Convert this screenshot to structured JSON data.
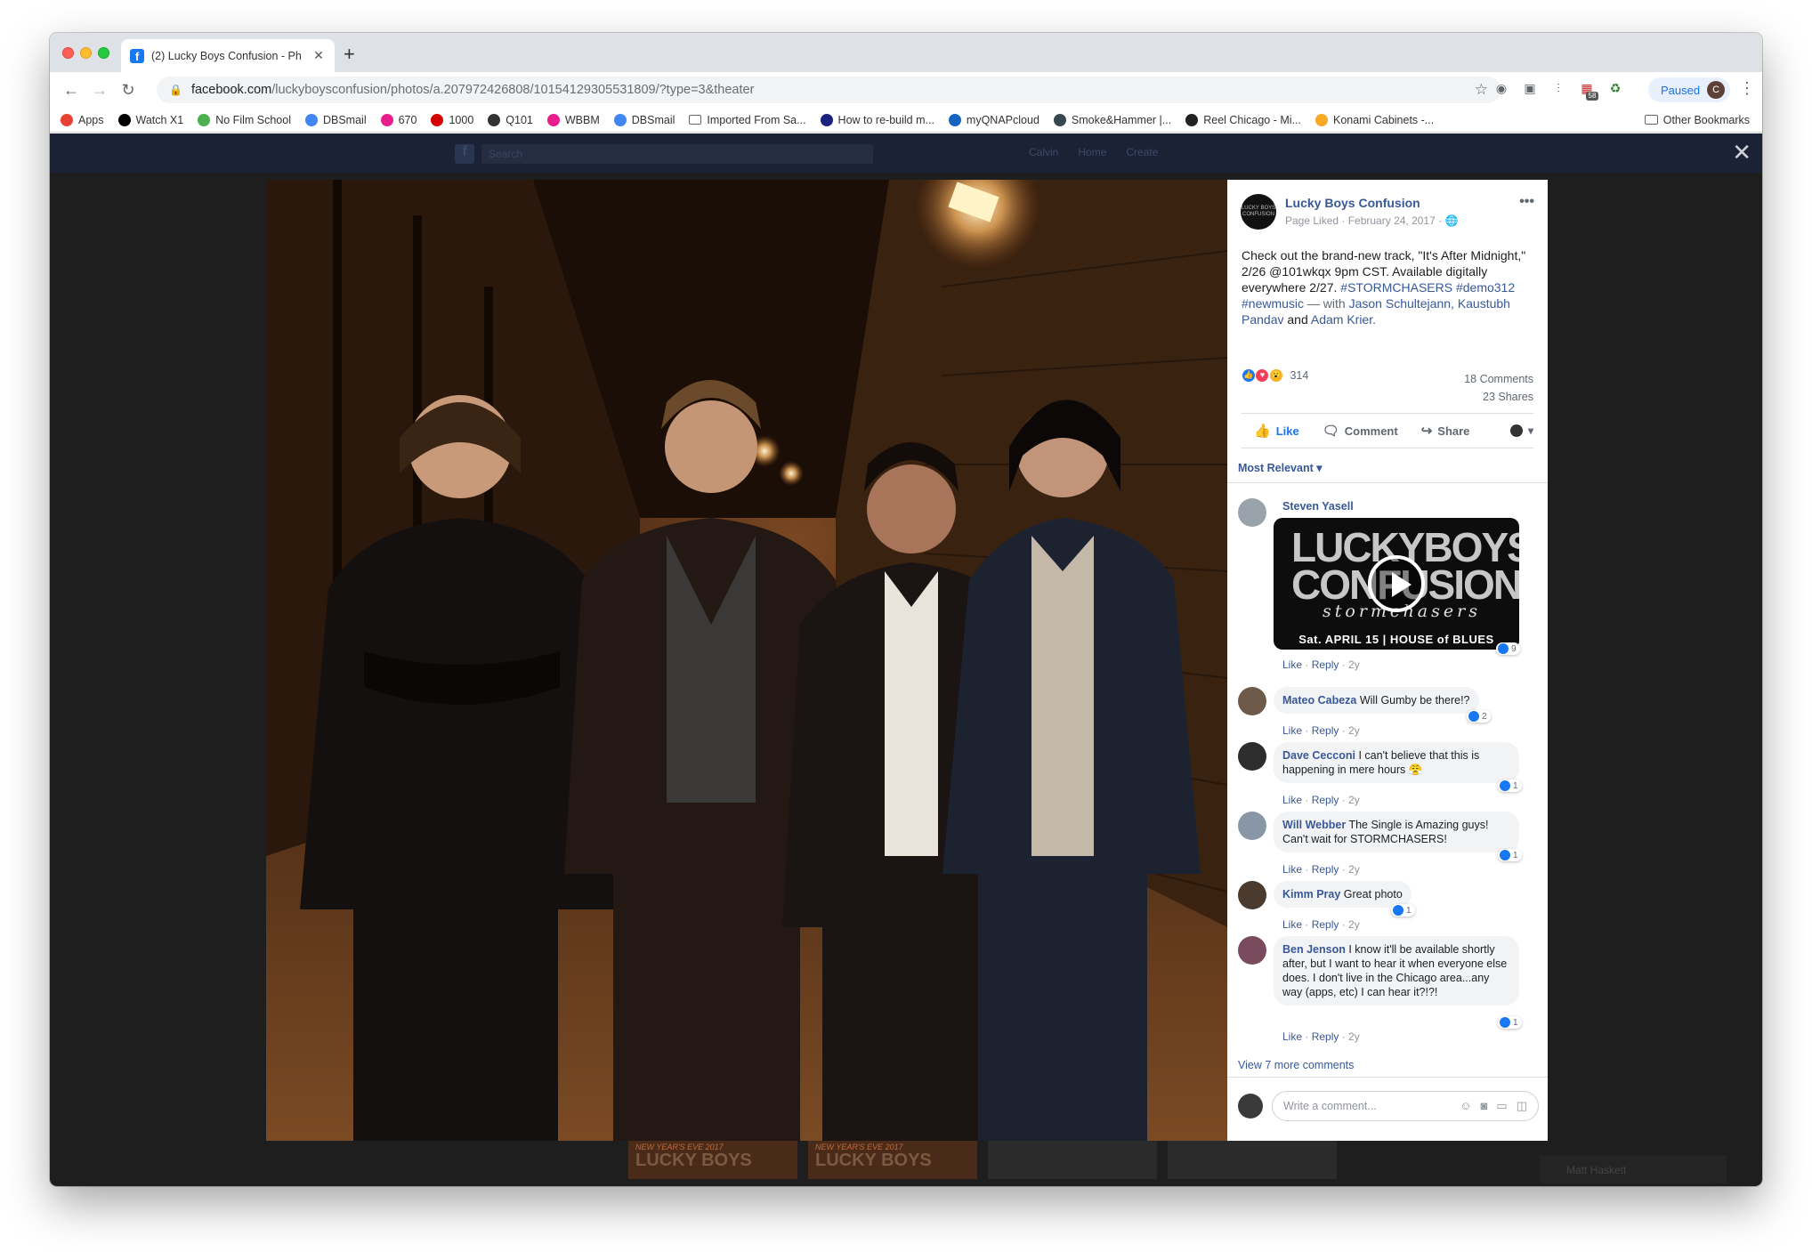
{
  "browser": {
    "tab_title": "(2) Lucky Boys Confusion - Ph",
    "tab_favicon": "f",
    "url_host": "facebook.com",
    "url_path": "/luckyboysconfusion/photos/a.207972426808/10154129305531809/?type=3&theater",
    "profile_status": "Paused",
    "profile_initial": "C",
    "ext_badge": "58"
  },
  "bookmarks": [
    {
      "label": "Apps",
      "icon": "apps-grid-icon",
      "color": "#e94235"
    },
    {
      "label": "Watch X1",
      "icon": "x1-icon",
      "color": "#000000"
    },
    {
      "label": "No Film School",
      "icon": "nfs-icon",
      "color": "#4caf50"
    },
    {
      "label": "DBSmail",
      "icon": "google-icon",
      "color": "#4285f4"
    },
    {
      "label": "670",
      "icon": "radio-icon",
      "color": "#e91e8c"
    },
    {
      "label": "1000",
      "icon": "espn-icon",
      "color": "#d50000"
    },
    {
      "label": "Q101",
      "icon": "q101-icon",
      "color": "#333333"
    },
    {
      "label": "WBBM",
      "icon": "radio-icon",
      "color": "#e91e8c"
    },
    {
      "label": "DBSmail",
      "icon": "google-icon",
      "color": "#4285f4"
    },
    {
      "label": "Imported From Sa...",
      "icon": "folder-icon",
      "color": "#666666"
    },
    {
      "label": "How to re-build m...",
      "icon": "video-icon",
      "color": "#1a237e"
    },
    {
      "label": "myQNAPcloud",
      "icon": "cloud-icon",
      "color": "#1565c0"
    },
    {
      "label": "Smoke&Hammer |...",
      "icon": "sh-icon",
      "color": "#37474f"
    },
    {
      "label": "Reel Chicago - Mi...",
      "icon": "rc-icon",
      "color": "#222222"
    },
    {
      "label": "Konami Cabinets -...",
      "icon": "konami-icon",
      "color": "#f9a825"
    }
  ],
  "bookmarks_other": "Other Bookmarks",
  "fb_bar": {
    "search_placeholder": "Search",
    "nav": [
      "Calvin",
      "Home",
      "Create"
    ]
  },
  "thumbnail_labels": [
    "NEW YEAR'S EVE 2017",
    "LUCKY BOYS"
  ],
  "chat_label": "Matt Haskett",
  "post": {
    "page_name": "Lucky Boys Confusion",
    "avatar_text": "LUCKY BOYS CONFUSION",
    "meta": "Page Liked · February 24, 2017 · ",
    "text_main": "Check out the brand-new track, \"It's After Midnight,\" 2/26 @101wkqx 9pm CST. Available digitally everywhere 2/27. ",
    "hashtag1": "#STORMCHASERS",
    "hashtag2": "#demo312",
    "hashtag3": "#newmusic",
    "with_text": " — with ",
    "tag1": "Jason Schultejann,",
    "tag2": "Kaustubh Pandav",
    "and_text": " and ",
    "tag3": "Adam Krier.",
    "reaction_count": "314",
    "comments_count": "18 Comments",
    "shares_count": "23 Shares",
    "actions": {
      "like": "Like",
      "comment": "Comment",
      "share": "Share"
    },
    "sort_label": "Most Relevant ▾",
    "view_more": "View 7 more comments",
    "write_placeholder": "Write a comment..."
  },
  "video_card": {
    "title_line1": "LUCKYBOYS",
    "title_line2": "CONFUSION",
    "subtitle": "stormchasers",
    "footer": "Sat. APRIL 15 | HOUSE of BLUES"
  },
  "comments": [
    {
      "name": "Steven Yasell",
      "text": "",
      "reacts": "9",
      "avatar_color": "#9aa3ab"
    },
    {
      "name": "Mateo Cabeza",
      "text": "Will Gumby be there!?",
      "reacts": "2",
      "avatar_color": "#6d5a4a"
    },
    {
      "name": "Dave Cecconi",
      "text": "I can't believe that this is happening in mere hours 😤",
      "reacts": "1",
      "avatar_color": "#2d2d2d"
    },
    {
      "name": "Will Webber",
      "text": "The Single is Amazing guys! Can't wait for STORMCHASERS!",
      "reacts": "1",
      "avatar_color": "#8896a6"
    },
    {
      "name": "Kimm Pray",
      "text": "Great photo",
      "reacts": "1",
      "avatar_color": "#4a3b2e"
    },
    {
      "name": "Ben Jenson",
      "text": "I know it'll be available shortly after, but I want to hear it when everyone else does. I don't live in the Chicago area...any way (apps, etc) I can hear it?!?!",
      "reacts": "1",
      "avatar_color": "#7a4b5c"
    }
  ],
  "comment_foot": {
    "like": "Like",
    "reply": "Reply",
    "age": "2y",
    "sep": " · "
  }
}
